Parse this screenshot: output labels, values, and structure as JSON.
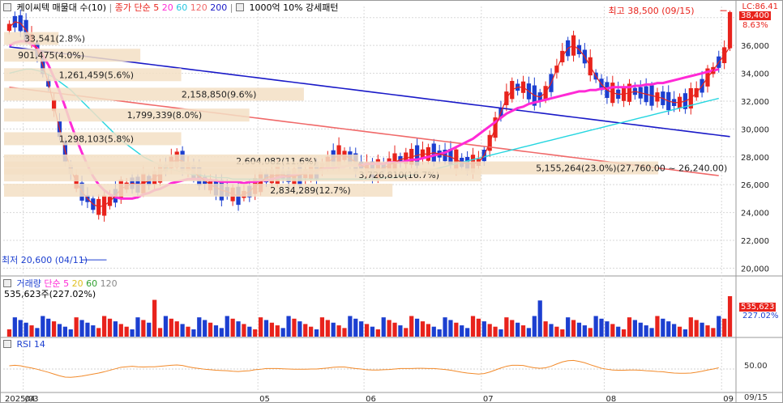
{
  "stock": {
    "name": "케이씨텍",
    "price_panel": {
      "ma_label": "매물대 수(10)",
      "legend": "종가 단순",
      "periods": [
        "5",
        "20",
        "60",
        "120",
        "200"
      ],
      "pattern_label": "1000억 10% 강세패턴"
    },
    "volume_panel": {
      "name": "거래량",
      "ma_label": "단순",
      "periods": [
        "5",
        "20",
        "60",
        "120"
      ],
      "value_text": "535,623주(227.02%)"
    },
    "rsi_panel": {
      "name": "RSI 14"
    }
  },
  "right_panel": {
    "lc_label": "LC:86.41",
    "price_badge": "38,400",
    "change_pct": "8.63%",
    "vol_badge": "535,623",
    "vol_pct": "227.02%",
    "rsi_tick": "50.00"
  },
  "annotations": {
    "high": "최고 38,500 (09/15)",
    "low": "최저 20,600 (04/11)",
    "blocks": [
      {
        "text": "33,541(2.8%)"
      },
      {
        "text": "901,475(4.0%)"
      },
      {
        "text": "1,261,459(5.6%)"
      },
      {
        "text": "2,158,850(9.6%)"
      },
      {
        "text": "1,799,339(8.0%)"
      },
      {
        "text": "1,298,103(5.8%)"
      },
      {
        "text": "2,604,082(11.6%)"
      },
      {
        "text": "2,834,289(12.7%)"
      },
      {
        "text": "3,726,810(16.7%)"
      },
      {
        "text": "5,155,264(23.0%)(27,760.00 ~ 26,240.00)"
      }
    ]
  },
  "x_axis": {
    "labels": [
      "2025/03",
      "04",
      "05",
      "06",
      "07",
      "08",
      "09"
    ],
    "right_label": "09/15"
  },
  "colors": {
    "up": "#e8231c",
    "down": "#1c3fd0",
    "ma5": "#e8231c",
    "ma20": "#ff2ad6",
    "ma60": "#25d6e0",
    "ma120": "#f06a6a",
    "ma200": "#1a1ac8",
    "block": "#f3dfc4",
    "rsi": "#f28a2a"
  },
  "chart_data": {
    "type": "candlestick",
    "y_ticks": [
      20000,
      22000,
      24000,
      26000,
      28000,
      30000,
      32000,
      34000,
      36000,
      38000
    ],
    "y_tick_labels": [
      "20,000",
      "22,000",
      "24,000",
      "26,000",
      "28,000",
      "30,000",
      "32,000",
      "34,000",
      "36,000"
    ],
    "ylim": [
      19500,
      38800
    ],
    "volume_ylim": [
      0,
      800000
    ],
    "rsi_ylim": [
      0,
      100
    ],
    "month_start_index": [
      0,
      3,
      45,
      64,
      85,
      107,
      128
    ],
    "ma5": [
      37300,
      37700,
      37600,
      37100,
      36500,
      35700,
      34600,
      33300,
      31700,
      30000,
      28400,
      27100,
      26200,
      25500,
      25000,
      24600,
      24400,
      24500,
      24800,
      25200,
      25700,
      25900,
      26100,
      26000,
      26100,
      26300,
      26500,
      26800,
      27200,
      27600,
      27800,
      27700,
      27300,
      26900,
      26600,
      26300,
      26000,
      25800,
      25600,
      25500,
      25300,
      25200,
      25300,
      25500,
      25900,
      26200,
      26500,
      26600,
      26700,
      26700,
      26600,
      26600,
      26700,
      26800,
      26900,
      27000,
      27300,
      27600,
      27900,
      28100,
      28100,
      27900,
      27600,
      27400,
      27200,
      27100,
      27100,
      27200,
      27400,
      27600,
      27800,
      27900,
      28000,
      28100,
      28200,
      28200,
      28300,
      28200,
      28100,
      28000,
      27800,
      27600,
      27500,
      27500,
      27600,
      28100,
      29000,
      30100,
      31200,
      32200,
      32800,
      33000,
      33000,
      32700,
      32400,
      32300,
      32600,
      33300,
      34300,
      35200,
      35800,
      36000,
      35700,
      35200,
      34500,
      33800,
      33200,
      32800,
      32600,
      32500,
      32500,
      32600,
      32700,
      32600,
      32500,
      32400,
      32300,
      32200,
      32000,
      31900,
      31900,
      32000,
      32200,
      32600,
      33100,
      33700,
      34200,
      34800,
      35300,
      35900
    ],
    "ma20": [
      36000,
      36200,
      36300,
      36300,
      36100,
      35800,
      35300,
      34600,
      33700,
      32700,
      31600,
      30400,
      29300,
      28300,
      27400,
      26600,
      26000,
      25600,
      25300,
      25100,
      25000,
      25000,
      25000,
      25100,
      25300,
      25400,
      25600,
      25700,
      25900,
      26100,
      26200,
      26300,
      26400,
      26400,
      26400,
      26400,
      26300,
      26300,
      26200,
      26200,
      26200,
      26200,
      26100,
      26200,
      26200,
      26300,
      26300,
      26400,
      26500,
      26600,
      26600,
      26700,
      26800,
      26900,
      26900,
      27000,
      27100,
      27200,
      27200,
      27300,
      27300,
      27400,
      27400,
      27400,
      27500,
      27500,
      27500,
      27500,
      27600,
      27600,
      27600,
      27700,
      27800,
      27800,
      27900,
      28000,
      28100,
      28200,
      28300,
      28500,
      28700,
      28900,
      29100,
      29300,
      29600,
      29900,
      30200,
      30500,
      30800,
      31100,
      31300,
      31500,
      31600,
      31800,
      31900,
      32000,
      32100,
      32200,
      32300,
      32400,
      32500,
      32600,
      32700,
      32700,
      32800,
      32800,
      32900,
      32900,
      33000,
      33000,
      33000,
      33000,
      33100,
      33100,
      33200,
      33200,
      33300,
      33300,
      33400,
      33500,
      33600,
      33700,
      33800,
      33900,
      34000,
      34100,
      34200,
      34300
    ],
    "ma60": [
      34000,
      34100,
      34200,
      34300,
      34300,
      34200,
      34100,
      33900,
      33700,
      33400,
      33100,
      32800,
      32400,
      32000,
      31600,
      31200,
      30800,
      30400,
      30000,
      29600,
      29200,
      28900,
      28600,
      28300,
      28000,
      27800,
      27600,
      27400,
      27200,
      27100,
      27000,
      26900,
      26800,
      26700,
      26700,
      26600,
      26600,
      26500,
      26500,
      26500,
      26400,
      26400,
      26400,
      26400,
      26400,
      26400,
      26400,
      26400,
      26400,
      26400,
      26400,
      26400,
      26400,
      26400,
      26400,
      26400,
      26400,
      26400,
      26400,
      26400,
      26400,
      26400,
      26400,
      26400,
      26400,
      26400,
      26400,
      26500,
      26500,
      26500,
      26600,
      26600,
      26700,
      26800,
      26900,
      27000,
      27100,
      27200,
      27300,
      27400,
      27500,
      27600,
      27700,
      27800,
      27900,
      28000,
      28100,
      28200,
      28300,
      28400,
      28500,
      28600,
      28700,
      28800,
      28900,
      29000,
      29100,
      29200,
      29300,
      29400,
      29500,
      29600,
      29700,
      29800,
      29900,
      30000,
      30100,
      30200,
      30300,
      30400,
      30500,
      30600,
      30700,
      30800,
      30900,
      31000,
      31100,
      31200,
      31300,
      31400,
      31500,
      31600,
      31700,
      31800,
      31900,
      32000,
      32100,
      32200
    ],
    "ma120": [
      33000,
      32950,
      32900,
      32850,
      32800,
      32750,
      32700,
      32650,
      32600,
      32550,
      32500,
      32450,
      32400,
      32350,
      32300,
      32250,
      32200,
      32150,
      32100,
      32050,
      32000,
      31950,
      31900,
      31850,
      31800,
      31750,
      31700,
      31650,
      31600,
      31550,
      31500,
      31450,
      31400,
      31350,
      31300,
      31250,
      31200,
      31150,
      31100,
      31050,
      31000,
      30950,
      30900,
      30850,
      30800,
      30750,
      30700,
      30650,
      30600,
      30550,
      30500,
      30450,
      30400,
      30350,
      30300,
      30250,
      30200,
      30150,
      30100,
      30050,
      30000,
      29950,
      29900,
      29850,
      29800,
      29750,
      29700,
      29650,
      29600,
      29550,
      29500,
      29450,
      29400,
      29350,
      29300,
      29250,
      29200,
      29150,
      29100,
      29050,
      29000,
      28950,
      28900,
      28850,
      28800,
      28750,
      28700,
      28650,
      28600,
      28550,
      28500,
      28450,
      28400,
      28350,
      28300,
      28250,
      28200,
      28150,
      28100,
      28050,
      28000,
      27950,
      27900,
      27850,
      27800,
      27750,
      27700,
      27650,
      27600,
      27550,
      27500,
      27450,
      27400,
      27350,
      27300,
      27250,
      27200,
      27150,
      27100,
      27050,
      27000,
      26950,
      26900,
      26850,
      26800,
      26750,
      26700,
      26650
    ],
    "ma200": [
      35900,
      35850,
      35800,
      35750,
      35700,
      35650,
      35600,
      35550,
      35500,
      35450,
      35400,
      35350,
      35300,
      35250,
      35200,
      35150,
      35100,
      35050,
      35000,
      34950,
      34900,
      34850,
      34800,
      34750,
      34700,
      34650,
      34600,
      34550,
      34500,
      34450,
      34400,
      34350,
      34300,
      34250,
      34200,
      34150,
      34100,
      34050,
      34000,
      33950,
      33900,
      33850,
      33800,
      33750,
      33700,
      33650,
      33600,
      33550,
      33500,
      33450,
      33400,
      33350,
      33300,
      33250,
      33200,
      33150,
      33100,
      33050,
      33000,
      32950,
      32900,
      32850,
      32800,
      32750,
      32700,
      32650,
      32600,
      32550,
      32500,
      32450,
      32400,
      32350,
      32300,
      32250,
      32200,
      32150,
      32100,
      32050,
      32000,
      31950,
      31900,
      31850,
      31800,
      31750,
      31700,
      31650,
      31600,
      31550,
      31500,
      31450,
      31400,
      31350,
      31300,
      31250,
      31200,
      31150,
      31100,
      31050,
      31000,
      30950,
      30900,
      30850,
      30800,
      30750,
      30700,
      30650,
      30600,
      30550,
      30500,
      30450,
      30400,
      30350,
      30300,
      30250,
      30200,
      30150,
      30100,
      30050,
      30000,
      29950,
      29900,
      29850,
      29800,
      29750,
      29700,
      29650,
      29600,
      29550,
      29500,
      29450
    ]
  }
}
